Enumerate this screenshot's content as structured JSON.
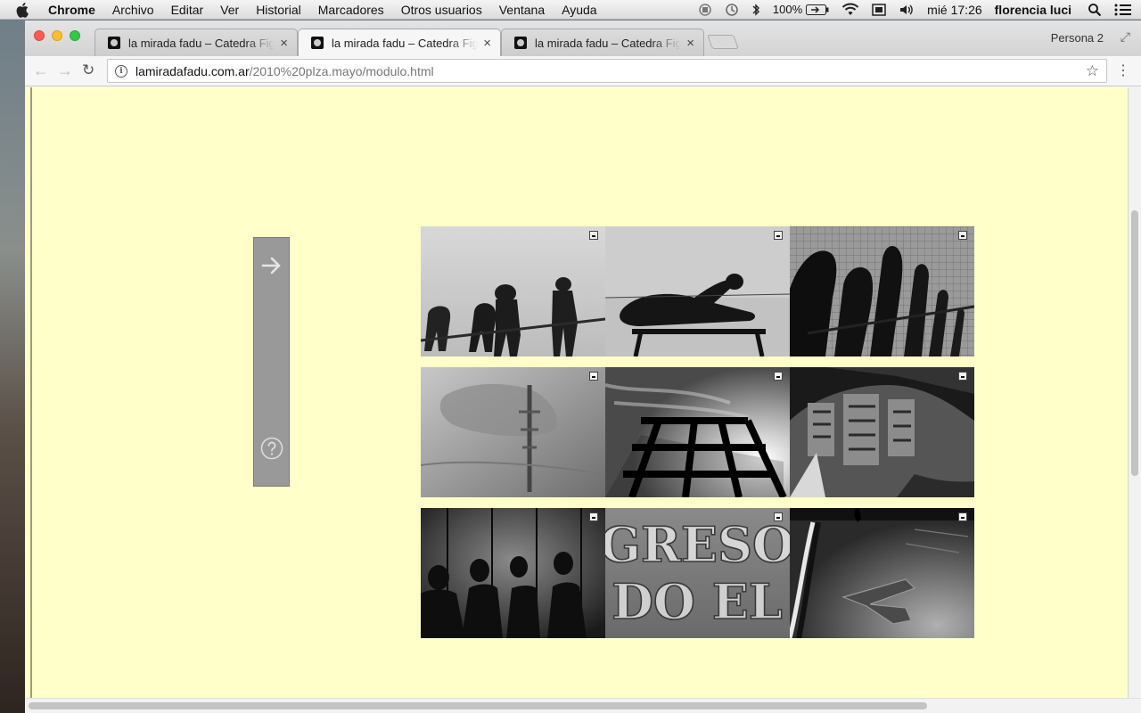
{
  "menubar": {
    "app_name": "Chrome",
    "menus": [
      "Archivo",
      "Editar",
      "Ver",
      "Historial",
      "Marcadores",
      "Otros usuarios",
      "Ventana",
      "Ayuda"
    ],
    "battery": "100%",
    "clock": "mié 17:26",
    "user": "florencia luci"
  },
  "browser": {
    "tabs": [
      {
        "title": "la mirada fadu – Catedra Figueroa"
      },
      {
        "title": "la mirada fadu – Catedra Figueroa"
      },
      {
        "title": "la mirada fadu – Catedra Figueroa"
      }
    ],
    "active_tab_index": 1,
    "profile": "Persona 2",
    "url_host": "lamiradafadu.com.ar",
    "url_path": "/2010%20plza.mayo/modulo.html"
  },
  "page": {
    "background_color": "#ffffc9",
    "sidepanel_color": "#999999",
    "sidepanel_icons": [
      "arrow-right-icon",
      "help-icon"
    ],
    "gallery": {
      "columns": 3,
      "rows": 3,
      "photos": [
        {
          "subject": "shadows-of-people-on-pavement"
        },
        {
          "subject": "shadow-of-person-reclining-on-bench"
        },
        {
          "subject": "shadows-on-tiled-wall"
        },
        {
          "subject": "reflection-in-puddle"
        },
        {
          "subject": "fence-against-sky"
        },
        {
          "subject": "building-reflection-in-puddle"
        },
        {
          "subject": "silhouettes-on-wall"
        },
        {
          "subject": "carved-letters"
        },
        {
          "subject": "road-with-arrow"
        }
      ],
      "carved_text_line1": "GRESO",
      "carved_text_line2": "DO EL"
    }
  }
}
